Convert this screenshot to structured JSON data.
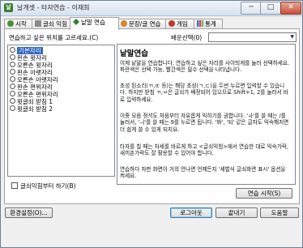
{
  "window": {
    "title": "날개셋 - 타자연습 - 이재희"
  },
  "title_buttons": {
    "minimize": "─",
    "maximize": "□",
    "close": "✕"
  },
  "tabs": [
    {
      "label": "시작"
    },
    {
      "label": "글쇠 익힘"
    },
    {
      "label": "낱말 연습"
    },
    {
      "label": "문장/글 연습"
    },
    {
      "label": "게임"
    },
    {
      "label": "통계"
    }
  ],
  "practice": {
    "prompt": "연습하고 싶은 위치를 고르세요.(C)",
    "font_label": "배운선택(0)",
    "font_value": "",
    "positions": [
      "기본자리",
      "왼손 윗자리",
      "오른손 윗자리",
      "왼손 아랫자리",
      "오른손 아랫자리",
      "왼손 편위자리",
      "오른손 편위자리",
      "윗글쇠 받침 1",
      "윗글쇠 받침 2"
    ],
    "checkbox_label": "글쇠익힘부터 하기(B)"
  },
  "description": {
    "title": "낱말연습",
    "paragraphs": [
      "이제 낱말을 연습합니다. 연습하고 싶은 자리를 사이띄게를 눌러 선택하세요. 파란색은 선택 가능, 빨간색은 필수 선택을 나타냅니다.",
      "초성 된소리(ㄲ,ㄸ 등)는 해당 초성(ㄱ,ㄷ)을 두번 누르면 입력할 수 있습니다. 하지만 받침 ㄲ,ㅆ은 글쇠가 배정되어 있으므로 Shift+1, 2를 눌러서 바로 입력하세요.",
      "이중 모음 정석도 처음부터 자유롭게 익히기를 권합니다. 'ㅘ'를 쓸 때는 /를 눌러서, 'ㅢ'를 쓸 때는 9를 누르면 됩니다. '봐', '되' 같은 글자도 익숙해지면 더 쉽게 쓸 수 있게 되지요.",
      "타자를 칠 때는 자세를 바르게 하고 <글쇠익힘>에서 연습한 대로 익숙가락, 새끼손가락도 잘 활용할 수 있어야 합니다.",
      "연습하다 자판 화면이 거의 안나면 언제든지 '세벌식 글쇠화면 표시' 옵션을 켜세요."
    ]
  },
  "buttons": {
    "start": "연습 시작(S)",
    "settings": "환경설정(O)...",
    "logout": "로그아웃",
    "exit": "끝내기",
    "help": "도움말"
  }
}
